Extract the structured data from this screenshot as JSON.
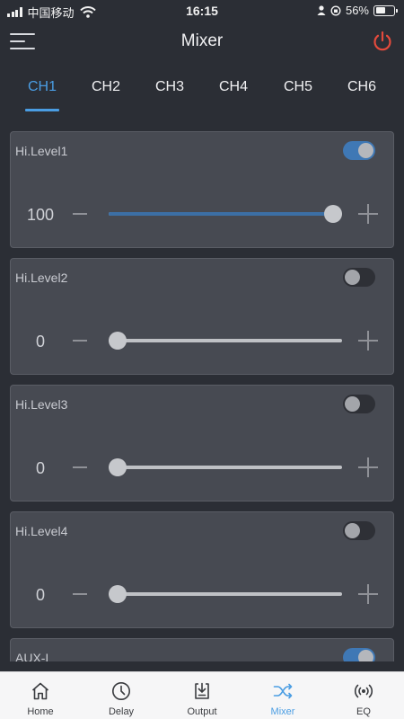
{
  "status_bar": {
    "carrier": "中国移动",
    "time": "16:15",
    "battery": "56%",
    "battery_level": 0.56
  },
  "header": {
    "title": "Mixer",
    "menu_icon": "menu-icon",
    "power_icon": "power-icon",
    "power_color": "#e34a3c"
  },
  "tabs": [
    {
      "label": "CH1",
      "active": true
    },
    {
      "label": "CH2",
      "active": false
    },
    {
      "label": "CH3",
      "active": false
    },
    {
      "label": "CH4",
      "active": false
    },
    {
      "label": "CH5",
      "active": false
    },
    {
      "label": "CH6",
      "active": false
    }
  ],
  "accent_color": "#4a9de3",
  "channels": [
    {
      "label": "Hi.Level1",
      "enabled": true,
      "value": "100",
      "level": 1.0
    },
    {
      "label": "Hi.Level2",
      "enabled": false,
      "value": "0",
      "level": 0.0
    },
    {
      "label": "Hi.Level3",
      "enabled": false,
      "value": "0",
      "level": 0.0
    },
    {
      "label": "Hi.Level4",
      "enabled": false,
      "value": "0",
      "level": 0.0
    },
    {
      "label": "AUX-L",
      "enabled": true,
      "value": "",
      "level": 0.0
    }
  ],
  "tab_bar": [
    {
      "label": "Home",
      "icon": "home-icon",
      "active": false
    },
    {
      "label": "Delay",
      "icon": "clock-icon",
      "active": false
    },
    {
      "label": "Output",
      "icon": "output-icon",
      "active": false
    },
    {
      "label": "Mixer",
      "icon": "mixer-icon",
      "active": true
    },
    {
      "label": "EQ",
      "icon": "eq-icon",
      "active": false
    }
  ]
}
